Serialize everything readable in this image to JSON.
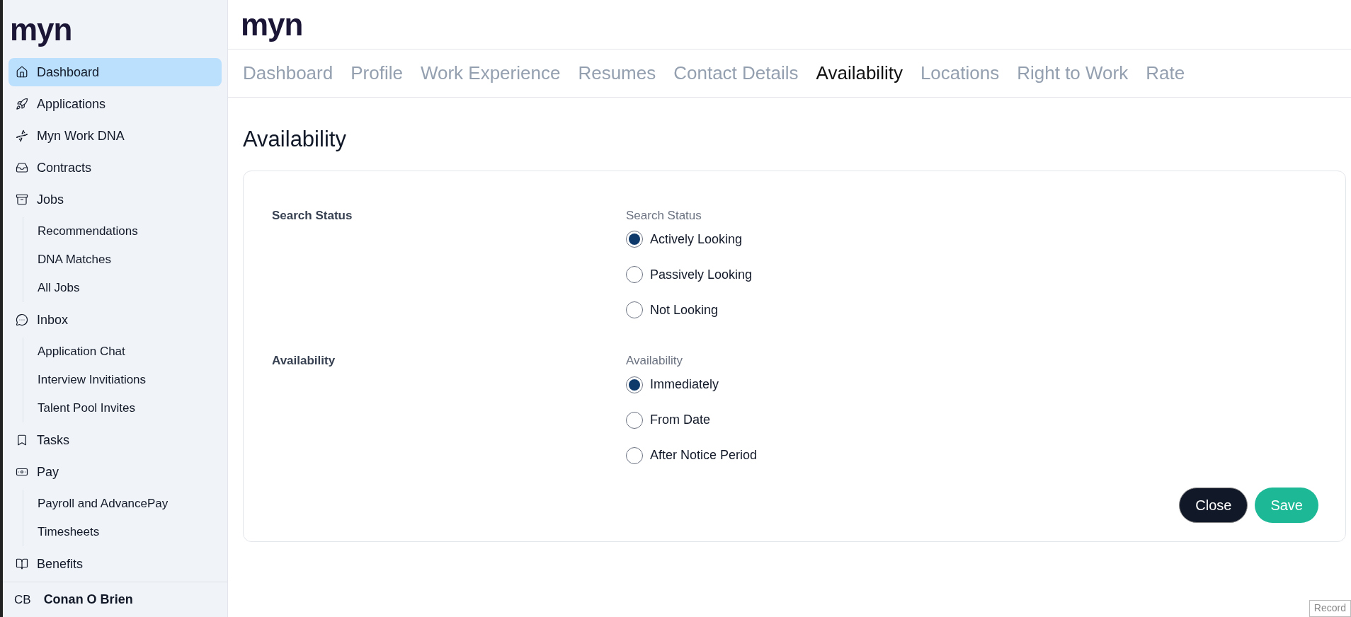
{
  "sidebar": {
    "logo": "myn",
    "items": [
      {
        "label": "Dashboard",
        "selected": true
      },
      {
        "label": "Applications",
        "selected": false
      },
      {
        "label": "Myn Work DNA",
        "selected": false
      },
      {
        "label": "Contracts",
        "selected": false
      },
      {
        "label": "Jobs",
        "selected": false,
        "children": [
          {
            "label": "Recommendations"
          },
          {
            "label": "DNA Matches"
          },
          {
            "label": "All Jobs"
          }
        ]
      },
      {
        "label": "Inbox",
        "selected": false,
        "children": [
          {
            "label": "Application Chat"
          },
          {
            "label": "Interview Invitiations"
          },
          {
            "label": "Talent Pool Invites"
          }
        ]
      },
      {
        "label": "Tasks",
        "selected": false
      },
      {
        "label": "Pay",
        "selected": false,
        "children": [
          {
            "label": "Payroll and AdvancePay"
          },
          {
            "label": "Timesheets"
          }
        ]
      },
      {
        "label": "Benefits",
        "selected": false
      }
    ],
    "user": {
      "initials": "CB",
      "name": "Conan O Brien"
    }
  },
  "header": {
    "logo": "myn"
  },
  "tabs": [
    {
      "label": "Dashboard",
      "selected": false
    },
    {
      "label": "Profile",
      "selected": false
    },
    {
      "label": "Work Experience",
      "selected": false
    },
    {
      "label": "Resumes",
      "selected": false
    },
    {
      "label": "Contact Details",
      "selected": false
    },
    {
      "label": "Availability",
      "selected": true
    },
    {
      "label": "Locations",
      "selected": false
    },
    {
      "label": "Right to Work",
      "selected": false
    },
    {
      "label": "Rate",
      "selected": false
    }
  ],
  "page_title": "Availability",
  "sections": [
    {
      "label": "Search Status",
      "field_label": "Search Status",
      "options": [
        {
          "label": "Actively Looking",
          "selected": true
        },
        {
          "label": "Passively Looking",
          "selected": false
        },
        {
          "label": "Not Looking",
          "selected": false
        }
      ]
    },
    {
      "label": "Availability",
      "field_label": "Availability",
      "options": [
        {
          "label": "Immediately",
          "selected": true
        },
        {
          "label": "From Date",
          "selected": false
        },
        {
          "label": "After Notice Period",
          "selected": false
        }
      ]
    }
  ],
  "buttons": [
    {
      "label": "Close",
      "kind": "secondary"
    },
    {
      "label": "Save",
      "kind": "primary"
    }
  ],
  "corner_tab": "Record"
}
